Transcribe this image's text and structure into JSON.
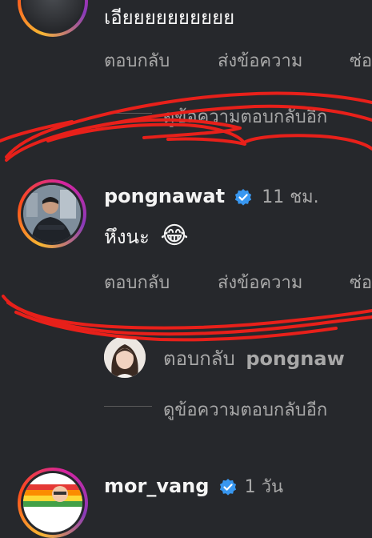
{
  "top_comment": {
    "partial_text": "เอียยยยยยยยยย"
  },
  "actions": {
    "reply": "ตอบกลับ",
    "send_message": "ส่งข้อความ",
    "more": "ซ่อ"
  },
  "view_replies": "ดูข้อความตอบกลับอีก",
  "comment": {
    "username": "pongnawat",
    "time": "11 ชม.",
    "text": "หึงนะ",
    "emoji": "😂"
  },
  "reply_box": {
    "prefix": "ตอบกลับ",
    "mention": "pongnaw"
  },
  "next_comment": {
    "username": "mor_vang",
    "time": "1 วัน"
  },
  "colors": {
    "verified": "#3897f0",
    "scribble": "#e8201a"
  }
}
